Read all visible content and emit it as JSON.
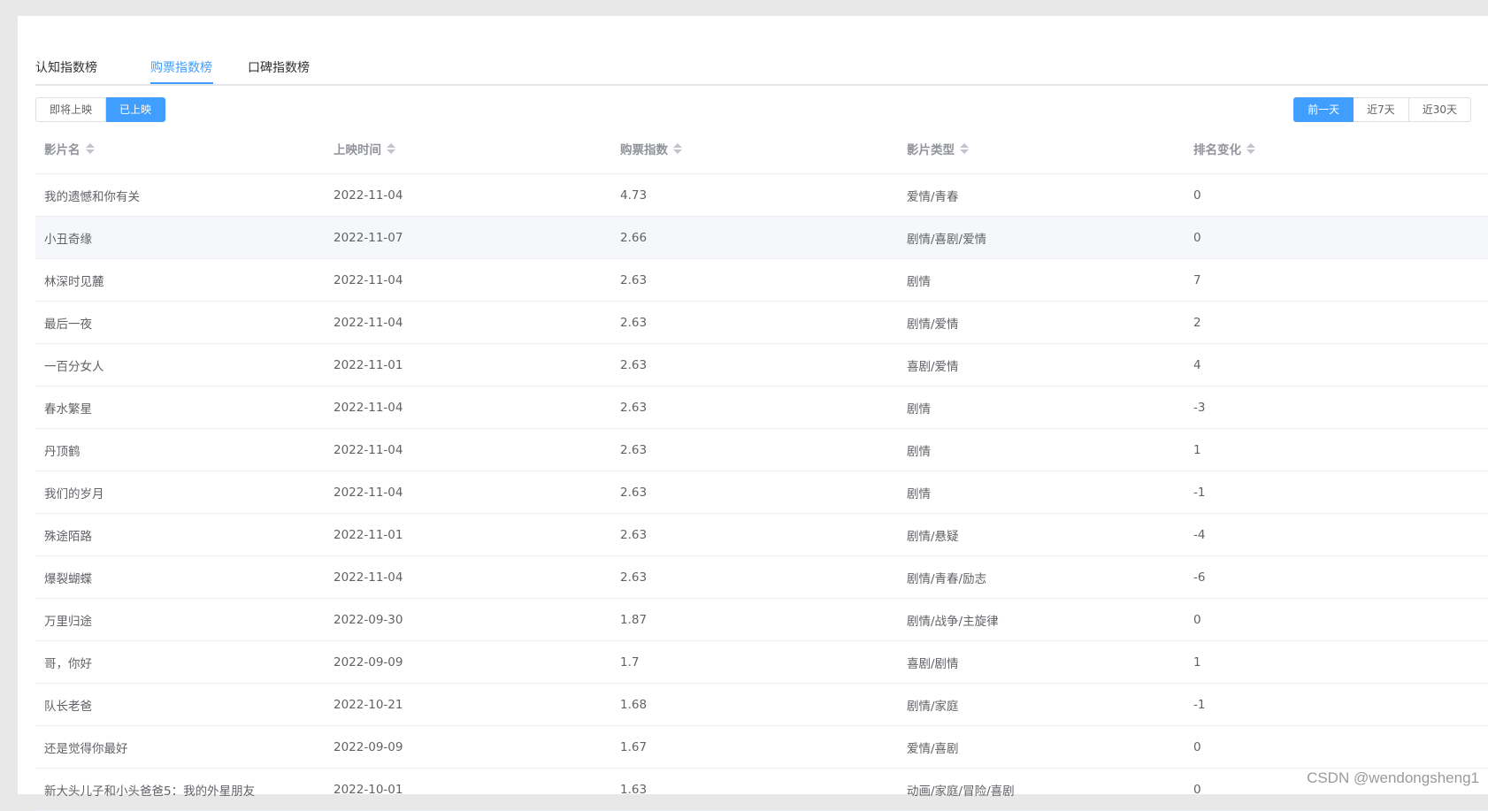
{
  "tabs": [
    "认知指数榜",
    "购票指数榜",
    "口碑指数榜"
  ],
  "status_filter": [
    "即将上映",
    "已上映"
  ],
  "status_active": "已上映",
  "range_filter": [
    "前一天",
    "近7天",
    "近30天"
  ],
  "range_active": "前一天",
  "table": {
    "columns": [
      "影片名",
      "上映时间",
      "购票指数",
      "影片类型",
      "排名变化"
    ],
    "rows": [
      [
        "我的遗憾和你有关",
        "2022-11-04",
        "4.73",
        "爱情/青春",
        "0"
      ],
      [
        "小丑奇缘",
        "2022-11-07",
        "2.66",
        "剧情/喜剧/爱情",
        "0"
      ],
      [
        "林深时见麓",
        "2022-11-04",
        "2.63",
        "剧情",
        "7"
      ],
      [
        "最后一夜",
        "2022-11-04",
        "2.63",
        "剧情/爱情",
        "2"
      ],
      [
        "一百分女人",
        "2022-11-01",
        "2.63",
        "喜剧/爱情",
        "4"
      ],
      [
        "春水繁星",
        "2022-11-04",
        "2.63",
        "剧情",
        "-3"
      ],
      [
        "丹顶鹤",
        "2022-11-04",
        "2.63",
        "剧情",
        "1"
      ],
      [
        "我们的岁月",
        "2022-11-04",
        "2.63",
        "剧情",
        "-1"
      ],
      [
        "殊途陌路",
        "2022-11-01",
        "2.63",
        "剧情/悬疑",
        "-4"
      ],
      [
        "爆裂蝴蝶",
        "2022-11-04",
        "2.63",
        "剧情/青春/励志",
        "-6"
      ],
      [
        "万里归途",
        "2022-09-30",
        "1.87",
        "剧情/战争/主旋律",
        "0"
      ],
      [
        "哥，你好",
        "2022-09-09",
        "1.7",
        "喜剧/剧情",
        "1"
      ],
      [
        "队长老爸",
        "2022-10-21",
        "1.68",
        "剧情/家庭",
        "-1"
      ],
      [
        "还是觉得你最好",
        "2022-09-09",
        "1.67",
        "爱情/喜剧",
        "0"
      ],
      [
        "新大头儿子和小头爸爸5：我的外星朋友",
        "2022-10-01",
        "1.63",
        "动画/家庭/冒险/喜剧",
        "0"
      ]
    ]
  },
  "watermark": "CSDN @wendongsheng1"
}
